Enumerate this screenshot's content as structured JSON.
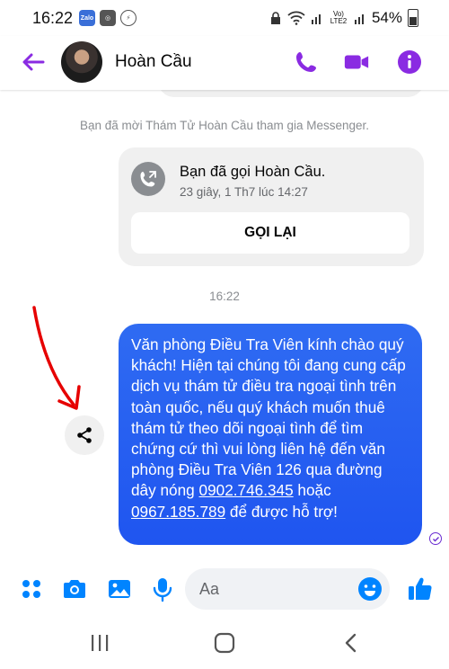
{
  "status_bar": {
    "time": "16:22",
    "app_icons": [
      "zalo-icon",
      "messenger-notification-icon",
      "messenger-icon"
    ],
    "battery": "54%",
    "network": "Vo) LTE2"
  },
  "header": {
    "contact_name": "Hoàn Cầu",
    "accent_color": "#8a2be2"
  },
  "chat": {
    "system_notice": "Bạn đã mời Thám Tử Hoàn Cầu tham gia Messenger.",
    "call_card": {
      "title": "Bạn đã gọi Hoàn Cầu.",
      "subtitle": "23 giây, 1 Th7 lúc 14:27",
      "callback_label": "GỌI LẠI"
    },
    "timestamp": "16:22",
    "outgoing_message": {
      "text_before": "Văn phòng Điều Tra Viên kính chào quý khách! Hiện tại chúng tôi đang cung cấp dịch vụ thám tử điều tra ngoại tình trên toàn quốc, nếu quý khách muốn thuê thám tử theo dõi ngoại tình để tìm chứng cứ thì vui lòng liên hệ đến văn phòng Điều Tra Viên 126 qua đường dây nóng",
      "phone_1": "0902.746.345",
      "connector": " hoặc ",
      "phone_2": "0967.185.789",
      "text_after": "để được hỗ trợ!",
      "bubble_color": "#2563f0"
    }
  },
  "composer": {
    "placeholder": "Aa"
  },
  "colors": {
    "messenger_blue": "#0084ff",
    "purple_accent": "#8a2be2",
    "annotation_red": "#e60000"
  }
}
